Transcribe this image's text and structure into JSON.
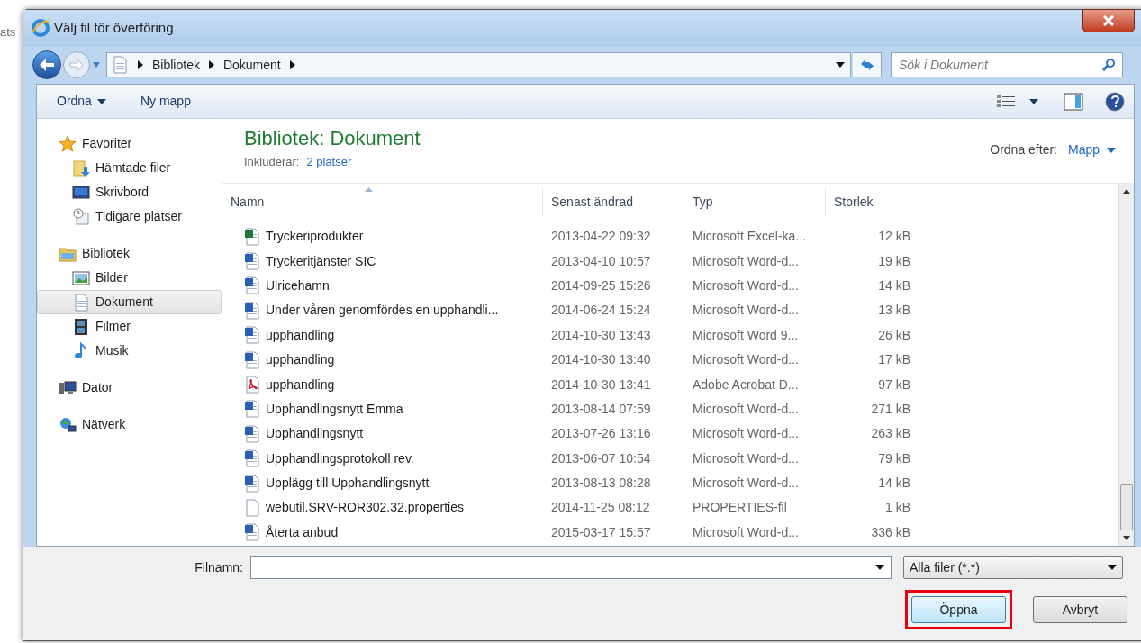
{
  "background_text": "ats",
  "window": {
    "title": "Välj fil för överföring"
  },
  "address": {
    "crumbs": [
      "Bibliotek",
      "Dokument"
    ]
  },
  "search": {
    "placeholder": "Sök i Dokument"
  },
  "toolbar": {
    "items": [
      {
        "label": "Ordna",
        "dropdown": true
      },
      {
        "label": "Ny mapp",
        "dropdown": false
      }
    ]
  },
  "sidebar": {
    "groups": [
      {
        "label": "Favoriter",
        "kind": "star",
        "items": [
          {
            "label": "Hämtade filer",
            "kind": "download",
            "selected": false
          },
          {
            "label": "Skrivbord",
            "kind": "desktop",
            "selected": false
          },
          {
            "label": "Tidigare platser",
            "kind": "recent",
            "selected": false
          }
        ]
      },
      {
        "label": "Bibliotek",
        "kind": "library",
        "items": [
          {
            "label": "Bilder",
            "kind": "pictures",
            "selected": false
          },
          {
            "label": "Dokument",
            "kind": "document",
            "selected": true
          },
          {
            "label": "Filmer",
            "kind": "film",
            "selected": false
          },
          {
            "label": "Musik",
            "kind": "music",
            "selected": false
          }
        ]
      },
      {
        "label": "Dator",
        "kind": "computer"
      },
      {
        "label": "Nätverk",
        "kind": "network"
      }
    ]
  },
  "library": {
    "title": "Bibliotek: Dokument",
    "includes_label": "Inkluderar:",
    "includes_link": "2 platser",
    "sort_label": "Ordna efter:",
    "sort_value": "Mapp"
  },
  "table": {
    "columns": [
      "Namn",
      "Senast ändrad",
      "Typ",
      "Storlek"
    ],
    "rows": [
      {
        "kind": "excel",
        "name": "Tryckeriprodukter",
        "date": "2013-04-22 09:32",
        "type": "Microsoft Excel-ka...",
        "size": "12 kB"
      },
      {
        "kind": "word",
        "name": "Tryckeritjänster SIC",
        "date": "2013-04-10 10:57",
        "type": "Microsoft Word-d...",
        "size": "19 kB"
      },
      {
        "kind": "word",
        "name": "Ulricehamn",
        "date": "2014-09-25 15:26",
        "type": "Microsoft Word-d...",
        "size": "14 kB"
      },
      {
        "kind": "word",
        "name": "Under våren genomfördes en upphandli...",
        "date": "2014-06-24 15:24",
        "type": "Microsoft Word-d...",
        "size": "13 kB"
      },
      {
        "kind": "word",
        "name": "upphandling",
        "date": "2014-10-30 13:43",
        "type": "Microsoft Word 9...",
        "size": "26 kB"
      },
      {
        "kind": "word",
        "name": "upphandling",
        "date": "2014-10-30 13:40",
        "type": "Microsoft Word-d...",
        "size": "17 kB"
      },
      {
        "kind": "pdf",
        "name": "upphandling",
        "date": "2014-10-30 13:41",
        "type": "Adobe Acrobat D...",
        "size": "97 kB"
      },
      {
        "kind": "word",
        "name": "Upphandlingsnytt Emma",
        "date": "2013-08-14 07:59",
        "type": "Microsoft Word-d...",
        "size": "271 kB"
      },
      {
        "kind": "word",
        "name": "Upphandlingsnytt",
        "date": "2013-07-26 13:16",
        "type": "Microsoft Word-d...",
        "size": "263 kB"
      },
      {
        "kind": "word",
        "name": "Upphandlingsprotokoll rev.",
        "date": "2013-06-07 10:54",
        "type": "Microsoft Word-d...",
        "size": "79 kB"
      },
      {
        "kind": "word",
        "name": "Upplägg till Upphandlingsnytt",
        "date": "2013-08-13 08:28",
        "type": "Microsoft Word-d...",
        "size": "14 kB"
      },
      {
        "kind": "file",
        "name": "webutil.SRV-ROR302.32.properties",
        "date": "2014-11-25 08:12",
        "type": "PROPERTIES-fil",
        "size": "1 kB"
      },
      {
        "kind": "word",
        "name": "Återta anbud",
        "date": "2015-03-17 15:57",
        "type": "Microsoft Word-d...",
        "size": "336 kB"
      }
    ]
  },
  "filename": {
    "label": "Filnamn:"
  },
  "filter": {
    "value": "Alla filer (*.*)"
  },
  "buttons": [
    {
      "label": "Öppna",
      "highlighted": true
    },
    {
      "label": "Avbryt",
      "highlighted": false
    }
  ]
}
